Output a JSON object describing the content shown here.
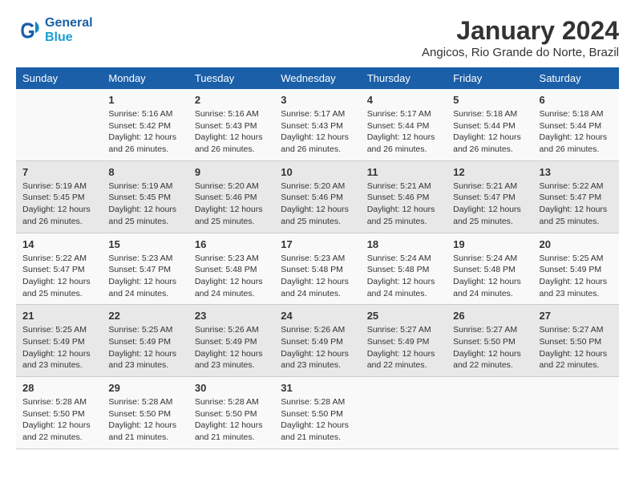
{
  "header": {
    "logo_line1": "General",
    "logo_line2": "Blue",
    "title": "January 2024",
    "subtitle": "Angicos, Rio Grande do Norte, Brazil"
  },
  "calendar": {
    "weekdays": [
      "Sunday",
      "Monday",
      "Tuesday",
      "Wednesday",
      "Thursday",
      "Friday",
      "Saturday"
    ],
    "rows": [
      [
        {
          "day": "",
          "info": ""
        },
        {
          "day": "1",
          "info": "Sunrise: 5:16 AM\nSunset: 5:42 PM\nDaylight: 12 hours\nand 26 minutes."
        },
        {
          "day": "2",
          "info": "Sunrise: 5:16 AM\nSunset: 5:43 PM\nDaylight: 12 hours\nand 26 minutes."
        },
        {
          "day": "3",
          "info": "Sunrise: 5:17 AM\nSunset: 5:43 PM\nDaylight: 12 hours\nand 26 minutes."
        },
        {
          "day": "4",
          "info": "Sunrise: 5:17 AM\nSunset: 5:44 PM\nDaylight: 12 hours\nand 26 minutes."
        },
        {
          "day": "5",
          "info": "Sunrise: 5:18 AM\nSunset: 5:44 PM\nDaylight: 12 hours\nand 26 minutes."
        },
        {
          "day": "6",
          "info": "Sunrise: 5:18 AM\nSunset: 5:44 PM\nDaylight: 12 hours\nand 26 minutes."
        }
      ],
      [
        {
          "day": "7",
          "info": "Sunrise: 5:19 AM\nSunset: 5:45 PM\nDaylight: 12 hours\nand 26 minutes."
        },
        {
          "day": "8",
          "info": "Sunrise: 5:19 AM\nSunset: 5:45 PM\nDaylight: 12 hours\nand 25 minutes."
        },
        {
          "day": "9",
          "info": "Sunrise: 5:20 AM\nSunset: 5:46 PM\nDaylight: 12 hours\nand 25 minutes."
        },
        {
          "day": "10",
          "info": "Sunrise: 5:20 AM\nSunset: 5:46 PM\nDaylight: 12 hours\nand 25 minutes."
        },
        {
          "day": "11",
          "info": "Sunrise: 5:21 AM\nSunset: 5:46 PM\nDaylight: 12 hours\nand 25 minutes."
        },
        {
          "day": "12",
          "info": "Sunrise: 5:21 AM\nSunset: 5:47 PM\nDaylight: 12 hours\nand 25 minutes."
        },
        {
          "day": "13",
          "info": "Sunrise: 5:22 AM\nSunset: 5:47 PM\nDaylight: 12 hours\nand 25 minutes."
        }
      ],
      [
        {
          "day": "14",
          "info": "Sunrise: 5:22 AM\nSunset: 5:47 PM\nDaylight: 12 hours\nand 25 minutes."
        },
        {
          "day": "15",
          "info": "Sunrise: 5:23 AM\nSunset: 5:47 PM\nDaylight: 12 hours\nand 24 minutes."
        },
        {
          "day": "16",
          "info": "Sunrise: 5:23 AM\nSunset: 5:48 PM\nDaylight: 12 hours\nand 24 minutes."
        },
        {
          "day": "17",
          "info": "Sunrise: 5:23 AM\nSunset: 5:48 PM\nDaylight: 12 hours\nand 24 minutes."
        },
        {
          "day": "18",
          "info": "Sunrise: 5:24 AM\nSunset: 5:48 PM\nDaylight: 12 hours\nand 24 minutes."
        },
        {
          "day": "19",
          "info": "Sunrise: 5:24 AM\nSunset: 5:48 PM\nDaylight: 12 hours\nand 24 minutes."
        },
        {
          "day": "20",
          "info": "Sunrise: 5:25 AM\nSunset: 5:49 PM\nDaylight: 12 hours\nand 23 minutes."
        }
      ],
      [
        {
          "day": "21",
          "info": "Sunrise: 5:25 AM\nSunset: 5:49 PM\nDaylight: 12 hours\nand 23 minutes."
        },
        {
          "day": "22",
          "info": "Sunrise: 5:25 AM\nSunset: 5:49 PM\nDaylight: 12 hours\nand 23 minutes."
        },
        {
          "day": "23",
          "info": "Sunrise: 5:26 AM\nSunset: 5:49 PM\nDaylight: 12 hours\nand 23 minutes."
        },
        {
          "day": "24",
          "info": "Sunrise: 5:26 AM\nSunset: 5:49 PM\nDaylight: 12 hours\nand 23 minutes."
        },
        {
          "day": "25",
          "info": "Sunrise: 5:27 AM\nSunset: 5:49 PM\nDaylight: 12 hours\nand 22 minutes."
        },
        {
          "day": "26",
          "info": "Sunrise: 5:27 AM\nSunset: 5:50 PM\nDaylight: 12 hours\nand 22 minutes."
        },
        {
          "day": "27",
          "info": "Sunrise: 5:27 AM\nSunset: 5:50 PM\nDaylight: 12 hours\nand 22 minutes."
        }
      ],
      [
        {
          "day": "28",
          "info": "Sunrise: 5:28 AM\nSunset: 5:50 PM\nDaylight: 12 hours\nand 22 minutes."
        },
        {
          "day": "29",
          "info": "Sunrise: 5:28 AM\nSunset: 5:50 PM\nDaylight: 12 hours\nand 21 minutes."
        },
        {
          "day": "30",
          "info": "Sunrise: 5:28 AM\nSunset: 5:50 PM\nDaylight: 12 hours\nand 21 minutes."
        },
        {
          "day": "31",
          "info": "Sunrise: 5:28 AM\nSunset: 5:50 PM\nDaylight: 12 hours\nand 21 minutes."
        },
        {
          "day": "",
          "info": ""
        },
        {
          "day": "",
          "info": ""
        },
        {
          "day": "",
          "info": ""
        }
      ]
    ]
  }
}
